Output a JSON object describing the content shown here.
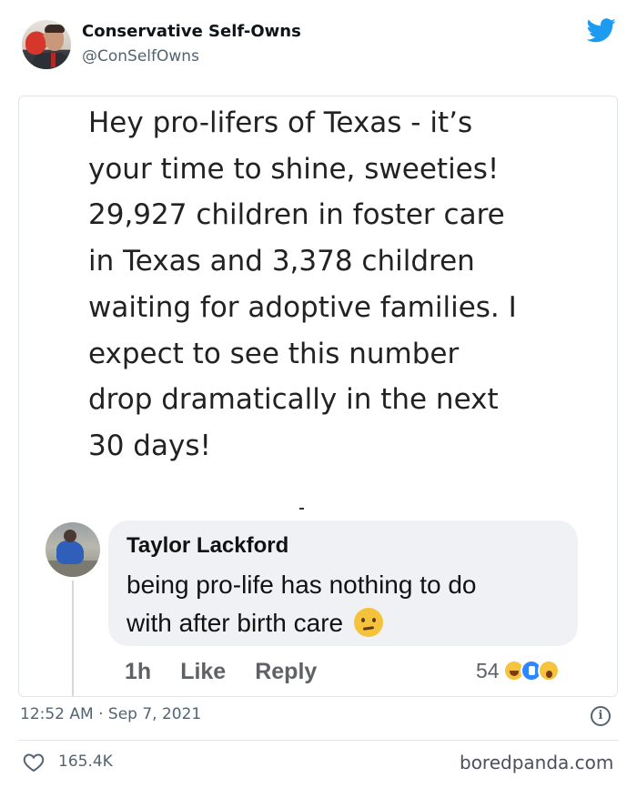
{
  "tweet": {
    "display_name": "Conservative Self-Owns",
    "handle": "@ConSelfOwns",
    "timestamp": "12:52 AM · Sep 7, 2021",
    "likes": "165.4K",
    "icons": {
      "avatar": "profile-avatar",
      "brand": "twitter-bird-icon",
      "info": "info-icon",
      "like": "heart-icon"
    },
    "colors": {
      "brand": "#1d9bf0",
      "secondary_text": "#536471"
    }
  },
  "post": {
    "lines": [
      "Hey pro-lifers of Texas - it’s",
      "your time to shine, sweeties!",
      "29,927 children in foster care",
      "in Texas and 3,378 children",
      "waiting for adoptive families. I",
      "expect to see this number",
      "drop dramatically in the next",
      "30 days!"
    ]
  },
  "comment": {
    "author": "Taylor Lackford",
    "lines": [
      "being pro-life has nothing to do",
      "with after birth care"
    ],
    "emoji": "raised-eyebrow-face",
    "age": "1h",
    "like_label": "Like",
    "reply_label": "Reply",
    "reaction_count": "54",
    "reactions": [
      "haha",
      "like",
      "wow"
    ]
  },
  "watermark": "boredpanda.com"
}
